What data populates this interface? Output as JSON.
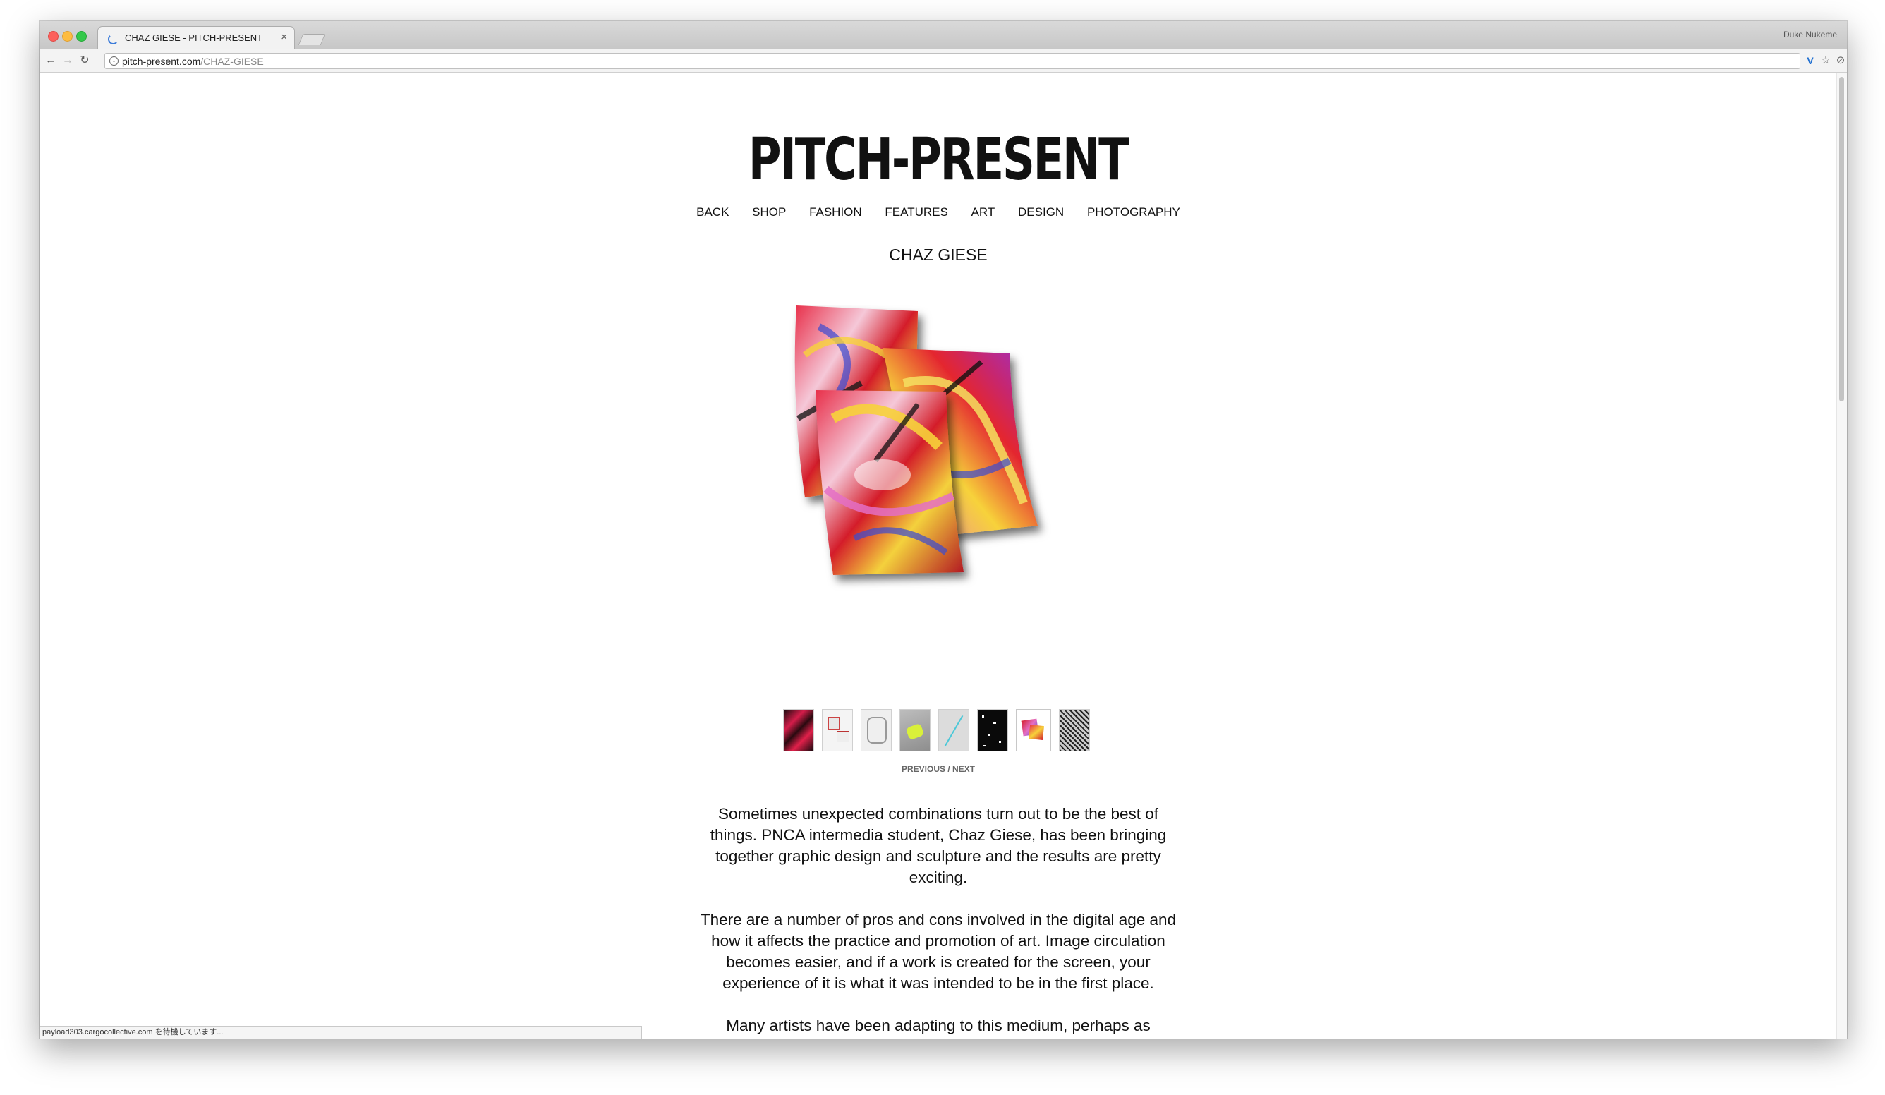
{
  "browser": {
    "tab_title": "CHAZ GIESE - PITCH-PRESENT",
    "tab_close": "×",
    "profile_name": "Duke Nukeme",
    "url_host": "pitch-present.com",
    "url_path": "/CHAZ-GIESE",
    "status_text": "payload303.cargocollective.com を待機しています..."
  },
  "site": {
    "logo": "PITCH-PRESENT",
    "nav": [
      "BACK",
      "SHOP",
      "FASHION",
      "FEATURES",
      "ART",
      "DESIGN",
      "PHOTOGRAPHY"
    ],
    "title": "CHAZ GIESE"
  },
  "gallery": {
    "thumbnails": [
      "red-black-streaks",
      "paper-cards",
      "line-drawing",
      "grey-yellow",
      "cyan-lines",
      "black-white-dots",
      "red-poster-stack",
      "bw-pattern"
    ],
    "selected_index": 6,
    "previous_label": "PREVIOUS",
    "separator": " / ",
    "next_label": "NEXT"
  },
  "article": {
    "paragraphs": [
      "Sometimes unexpected combinations turn out to be the best of things. PNCA intermedia student, Chaz Giese, has been bringing together graphic design and sculpture and the results are pretty exciting.",
      "There are a number of pros and cons involved in the digital age and how it affects the practice and promotion of art. Image circulation becomes easier, and if a work is created for the screen, your experience of it is what it was intended to be in the first place.",
      "Many artists have been adapting to this medium, perhaps as"
    ]
  },
  "colors": {
    "spinner": "#3b7bd9",
    "art_red": "#d8202a",
    "art_yellow": "#f7d23a",
    "art_blue": "#3a4ad0",
    "art_pink": "#e870c8"
  }
}
